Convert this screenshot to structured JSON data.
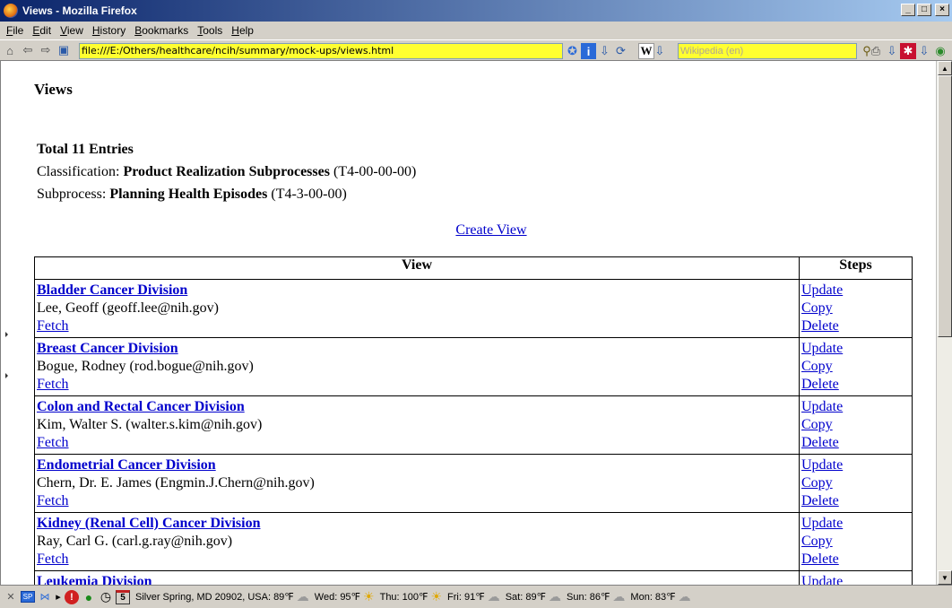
{
  "window": {
    "title": "Views - Mozilla Firefox",
    "buttons": {
      "minimize": "_",
      "maximize": "□",
      "close": "×"
    }
  },
  "menu": [
    "File",
    "Edit",
    "View",
    "History",
    "Bookmarks",
    "Tools",
    "Help"
  ],
  "navbar": {
    "url": "file:///E:/Others/healthcare/ncih/summary/mock-ups/views.html",
    "search_logo": "W",
    "search_placeholder": "Wikipedia (en)"
  },
  "page": {
    "heading": "Views",
    "total": "Total 11 Entries",
    "classification_label": "Classification: ",
    "classification_name": "Product Realization Subprocesses",
    "classification_code": " (T4-00-00-00)",
    "subprocess_label": "Subprocess: ",
    "subprocess_name": "Planning Health Episodes",
    "subprocess_code": " (T4-3-00-00)",
    "create_view": "Create View",
    "table": {
      "col_view": "View",
      "col_steps": "Steps",
      "step_update": "Update",
      "step_copy": "Copy",
      "step_delete": "Delete",
      "fetch": "Fetch",
      "rows": [
        {
          "name": "Bladder Cancer Division",
          "contact": "Lee, Geoff (geoff.lee@nih.gov)"
        },
        {
          "name": "Breast Cancer Division",
          "contact": "Bogue, Rodney (rod.bogue@nih.gov)"
        },
        {
          "name": "Colon and Rectal Cancer Division",
          "contact": "Kim, Walter S. (walter.s.kim@nih.gov)"
        },
        {
          "name": "Endometrial Cancer Division",
          "contact": "Chern, Dr. E. James (Engmin.J.Chern@nih.gov)"
        },
        {
          "name": "Kidney (Renal Cell) Cancer Division",
          "contact": "Ray, Carl G. (carl.g.ray@nih.gov)"
        },
        {
          "name": "Leukemia Division",
          "contact": ""
        }
      ]
    }
  },
  "status": {
    "sp_badge": "SP",
    "calendar_day": "5",
    "weather": [
      {
        "text": "Silver Spring, MD 20902, USA: 89℉",
        "icon": "cloud-icon"
      },
      {
        "text": "Wed: 95℉",
        "icon": "sun-icon"
      },
      {
        "text": "Thu: 100℉",
        "icon": "sun-icon"
      },
      {
        "text": "Fri: 91℉",
        "icon": "cloud-icon"
      },
      {
        "text": "Sat: 89℉",
        "icon": "cloud-icon"
      },
      {
        "text": "Sun: 86℉",
        "icon": "cloud-icon"
      },
      {
        "text": "Mon: 83℉",
        "icon": "cloud-icon"
      }
    ]
  }
}
